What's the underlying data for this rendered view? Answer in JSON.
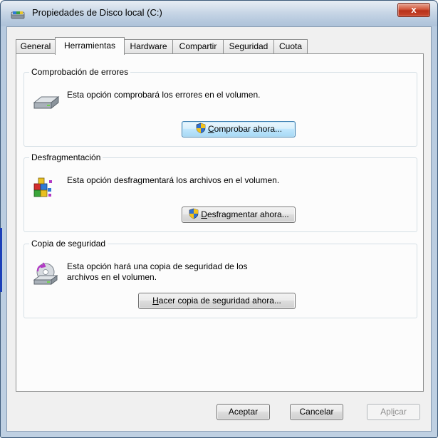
{
  "window": {
    "title": "Propiedades de Disco local (C:)",
    "close_label": "x"
  },
  "tabs": [
    {
      "label": "General"
    },
    {
      "label": "Herramientas"
    },
    {
      "label": "Hardware"
    },
    {
      "label": "Compartir"
    },
    {
      "label": "Seguridad"
    },
    {
      "label": "Cuota"
    }
  ],
  "active_tab": "Herramientas",
  "groups": {
    "error_check": {
      "title": "Comprobación de errores",
      "description": "Esta opción comprobará los errores en el volumen.",
      "button_access_key": "C",
      "button_rest": "omprobar ahora..."
    },
    "defrag": {
      "title": "Desfragmentación",
      "description": "Esta opción desfragmentará los archivos en el volumen.",
      "button_access_key": "D",
      "button_rest": "esfragmentar ahora..."
    },
    "backup": {
      "title": "Copia de seguridad",
      "description": "Esta opción hará una copia de seguridad de los archivos en el volumen.",
      "button_access_key": "H",
      "button_rest": "acer copia de seguridad ahora..."
    }
  },
  "footer": {
    "ok_label": "Aceptar",
    "cancel_label": "Cancelar",
    "apply_pre": "Apl",
    "apply_key": "i",
    "apply_post": "car"
  },
  "colors": {
    "accent": "#3c7fb1",
    "close_button": "#c8482e",
    "panel_background": "#fcfcfc"
  }
}
